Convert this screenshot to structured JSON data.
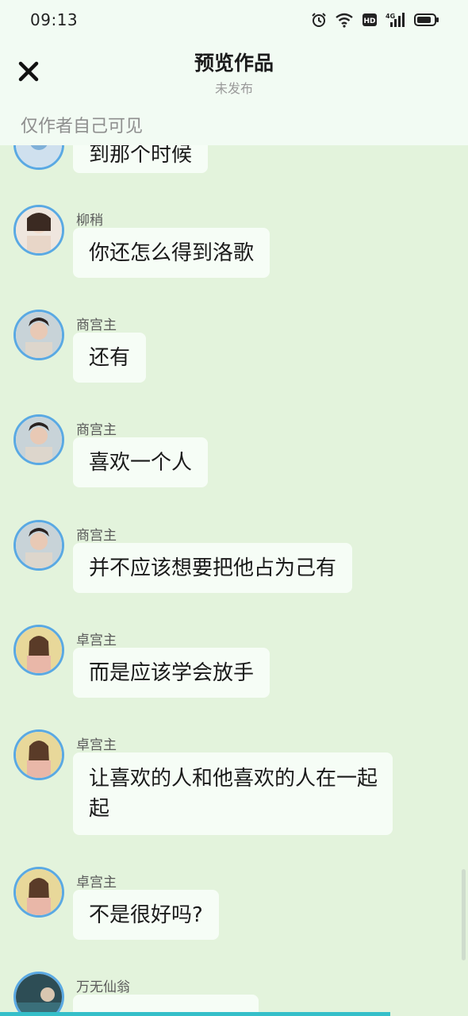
{
  "status_bar": {
    "time": "09:13",
    "icons": [
      "alarm-icon",
      "wifi-icon",
      "hd-icon",
      "4g-signal-icon",
      "battery-icon"
    ],
    "hd_label": "HD",
    "network_label": "4G"
  },
  "header": {
    "close_icon": "close-icon",
    "title": "预览作品",
    "subtitle": "未发布",
    "visibility_note": "仅作者自己可见"
  },
  "messages": [
    {
      "sender": "",
      "text": "到那个时候",
      "avatar_color": "#7fb0d8"
    },
    {
      "sender": "柳稍",
      "text": "你还怎么得到洛歌",
      "avatar_color": "#e8d6c8"
    },
    {
      "sender": "商宫主",
      "text": "还有",
      "avatar_color": "#6b5a4e"
    },
    {
      "sender": "商宫主",
      "text": "喜欢一个人",
      "avatar_color": "#6b5a4e"
    },
    {
      "sender": "商宫主",
      "text": "并不应该想要把他占为己有",
      "avatar_color": "#6b5a4e"
    },
    {
      "sender": "卓宫主",
      "text": "而是应该学会放手",
      "avatar_color": "#e9b7a8"
    },
    {
      "sender": "卓宫主",
      "text": "让喜欢的人和他喜欢的人在一起",
      "line2": "起",
      "avatar_color": "#e9b7a8"
    },
    {
      "sender": "卓宫主",
      "text": "不是很好吗?",
      "avatar_color": "#e9b7a8"
    },
    {
      "sender": "万无仙翁",
      "text": "",
      "avatar_color": "#3a6f7a"
    }
  ],
  "colors": {
    "background": "#e3f3dc",
    "header": "#f2fbf3",
    "bubble": "#f6fdf6",
    "avatar_ring": "#5aa9e3",
    "bottom_bar": "#35bfc9"
  }
}
